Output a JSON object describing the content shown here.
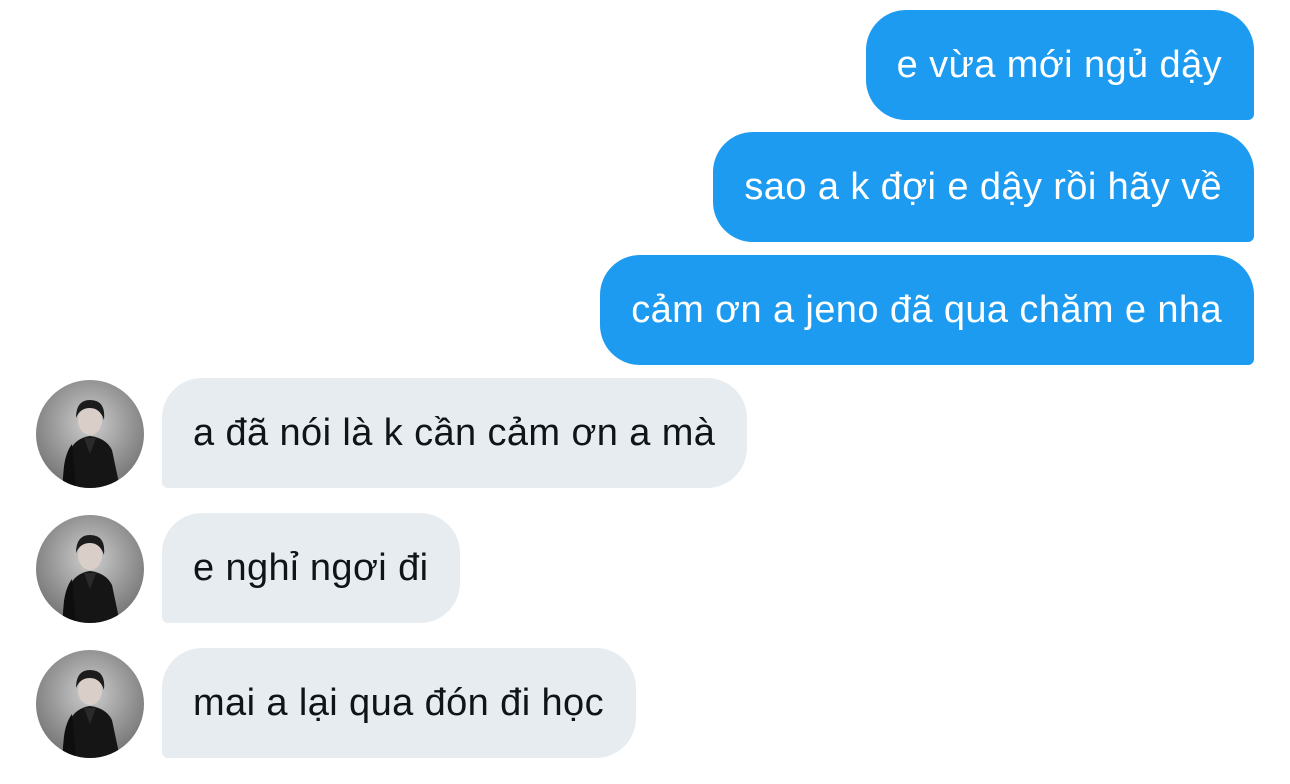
{
  "messages": [
    {
      "direction": "sent",
      "text": "e vừa mới ngủ dậy"
    },
    {
      "direction": "sent",
      "text": "sao a k đợi e dậy rồi hãy về"
    },
    {
      "direction": "sent",
      "text": "cảm ơn a jeno đã qua chăm e nha"
    },
    {
      "direction": "received",
      "text": "a đã nói là k cần cảm ơn a mà",
      "avatar": "contact-avatar"
    },
    {
      "direction": "received",
      "text": "e nghỉ ngơi đi",
      "avatar": "contact-avatar"
    },
    {
      "direction": "received",
      "text": "mai a lại qua đón đi học",
      "avatar": "contact-avatar"
    }
  ],
  "colors": {
    "sent_bubble": "#1d9bf0",
    "sent_text": "#ffffff",
    "received_bubble": "#e7ecf0",
    "received_text": "#0f1419",
    "background": "#ffffff"
  }
}
